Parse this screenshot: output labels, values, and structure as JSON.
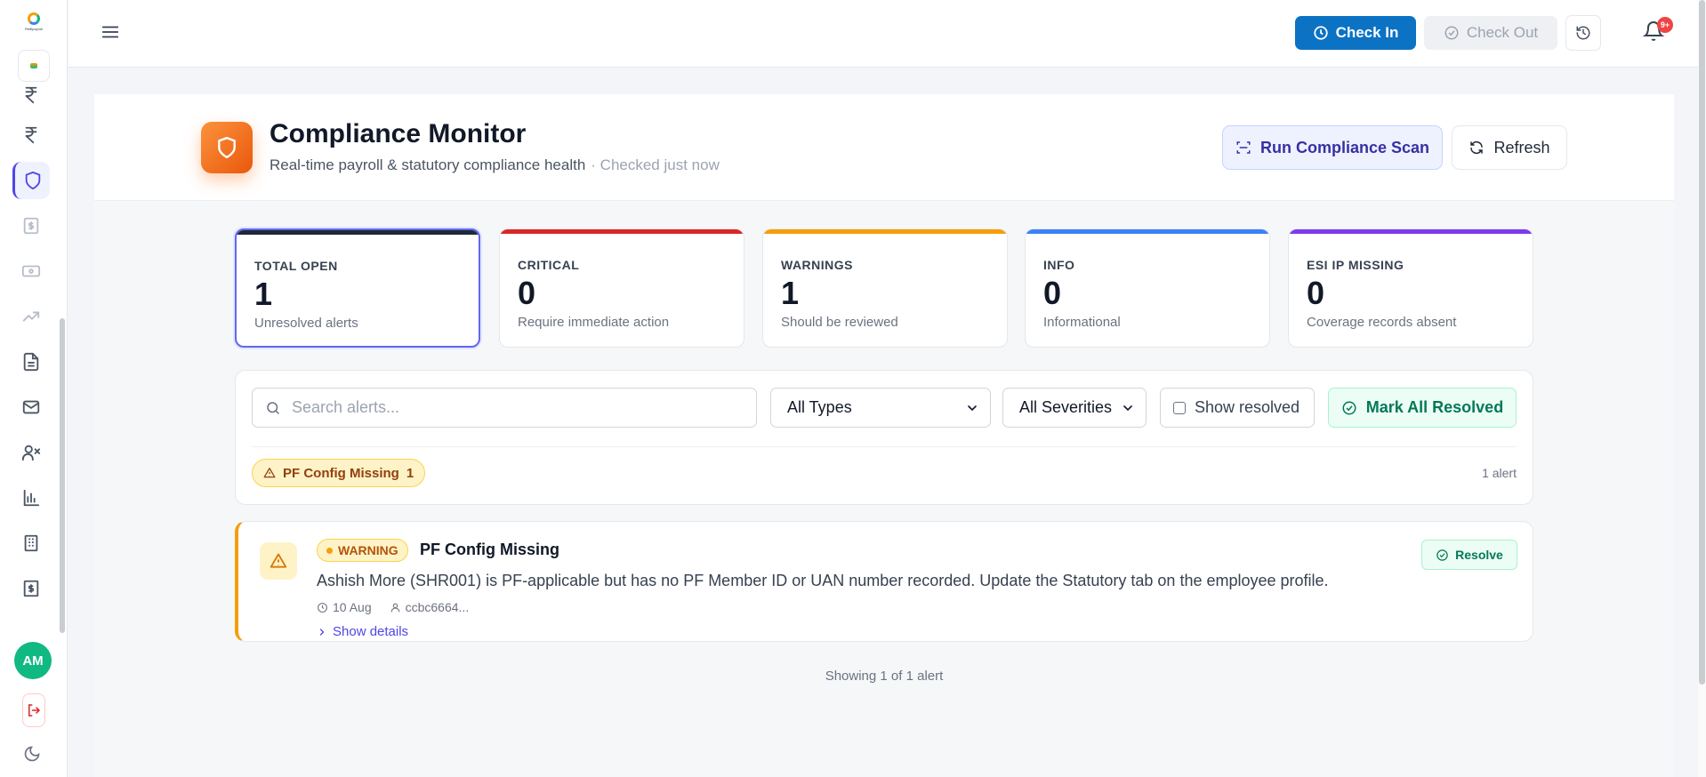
{
  "sidebar": {
    "logo_text": "Reffipayroll",
    "avatar_initials": "AM",
    "items": [
      {
        "icon": "rupee-icon"
      },
      {
        "icon": "rupee-icon"
      },
      {
        "icon": "shield-icon",
        "active": true
      },
      {
        "icon": "dollar-doc-icon"
      },
      {
        "icon": "banknote-icon"
      },
      {
        "icon": "trending-up-icon"
      },
      {
        "icon": "file-text-icon"
      },
      {
        "icon": "mail-icon"
      },
      {
        "icon": "user-x-icon"
      },
      {
        "icon": "bar-chart-icon"
      },
      {
        "icon": "building-icon"
      },
      {
        "icon": "receipt-icon"
      }
    ]
  },
  "topbar": {
    "check_in_label": "Check In",
    "check_out_label": "Check Out",
    "notification_badge": "9+"
  },
  "header": {
    "title": "Compliance Monitor",
    "subtitle": "Real-time payroll & statutory compliance health",
    "checked_text": "· Checked just now",
    "scan_button": "Run Compliance Scan",
    "refresh_button": "Refresh"
  },
  "stats": [
    {
      "label": "TOTAL OPEN",
      "value": "1",
      "desc": "Unresolved alerts",
      "color": "#1f2937"
    },
    {
      "label": "CRITICAL",
      "value": "0",
      "desc": "Require immediate action",
      "color": "#dc2626"
    },
    {
      "label": "WARNINGS",
      "value": "1",
      "desc": "Should be reviewed",
      "color": "#f59e0b"
    },
    {
      "label": "INFO",
      "value": "0",
      "desc": "Informational",
      "color": "#3b82f6"
    },
    {
      "label": "ESI IP MISSING",
      "value": "0",
      "desc": "Coverage records absent",
      "color": "#7c3aed"
    }
  ],
  "filters": {
    "search_placeholder": "Search alerts...",
    "type_select": "All Types",
    "severity_select": "All Severities",
    "show_resolved_label": "Show resolved",
    "mark_all_label": "Mark All Resolved",
    "chip_label": "PF Config Missing",
    "chip_count": "1",
    "alert_count_text": "1 alert"
  },
  "alert": {
    "severity": "WARNING",
    "title": "PF Config Missing",
    "description": "Ashish More (SHR001) is PF-applicable but has no PF Member ID or UAN number recorded. Update the Statutory tab on the employee profile.",
    "date": "10 Aug",
    "user": "ccbc6664...",
    "details_label": "Show details",
    "resolve_label": "Resolve"
  },
  "footer_text": "Showing 1 of 1 alert"
}
